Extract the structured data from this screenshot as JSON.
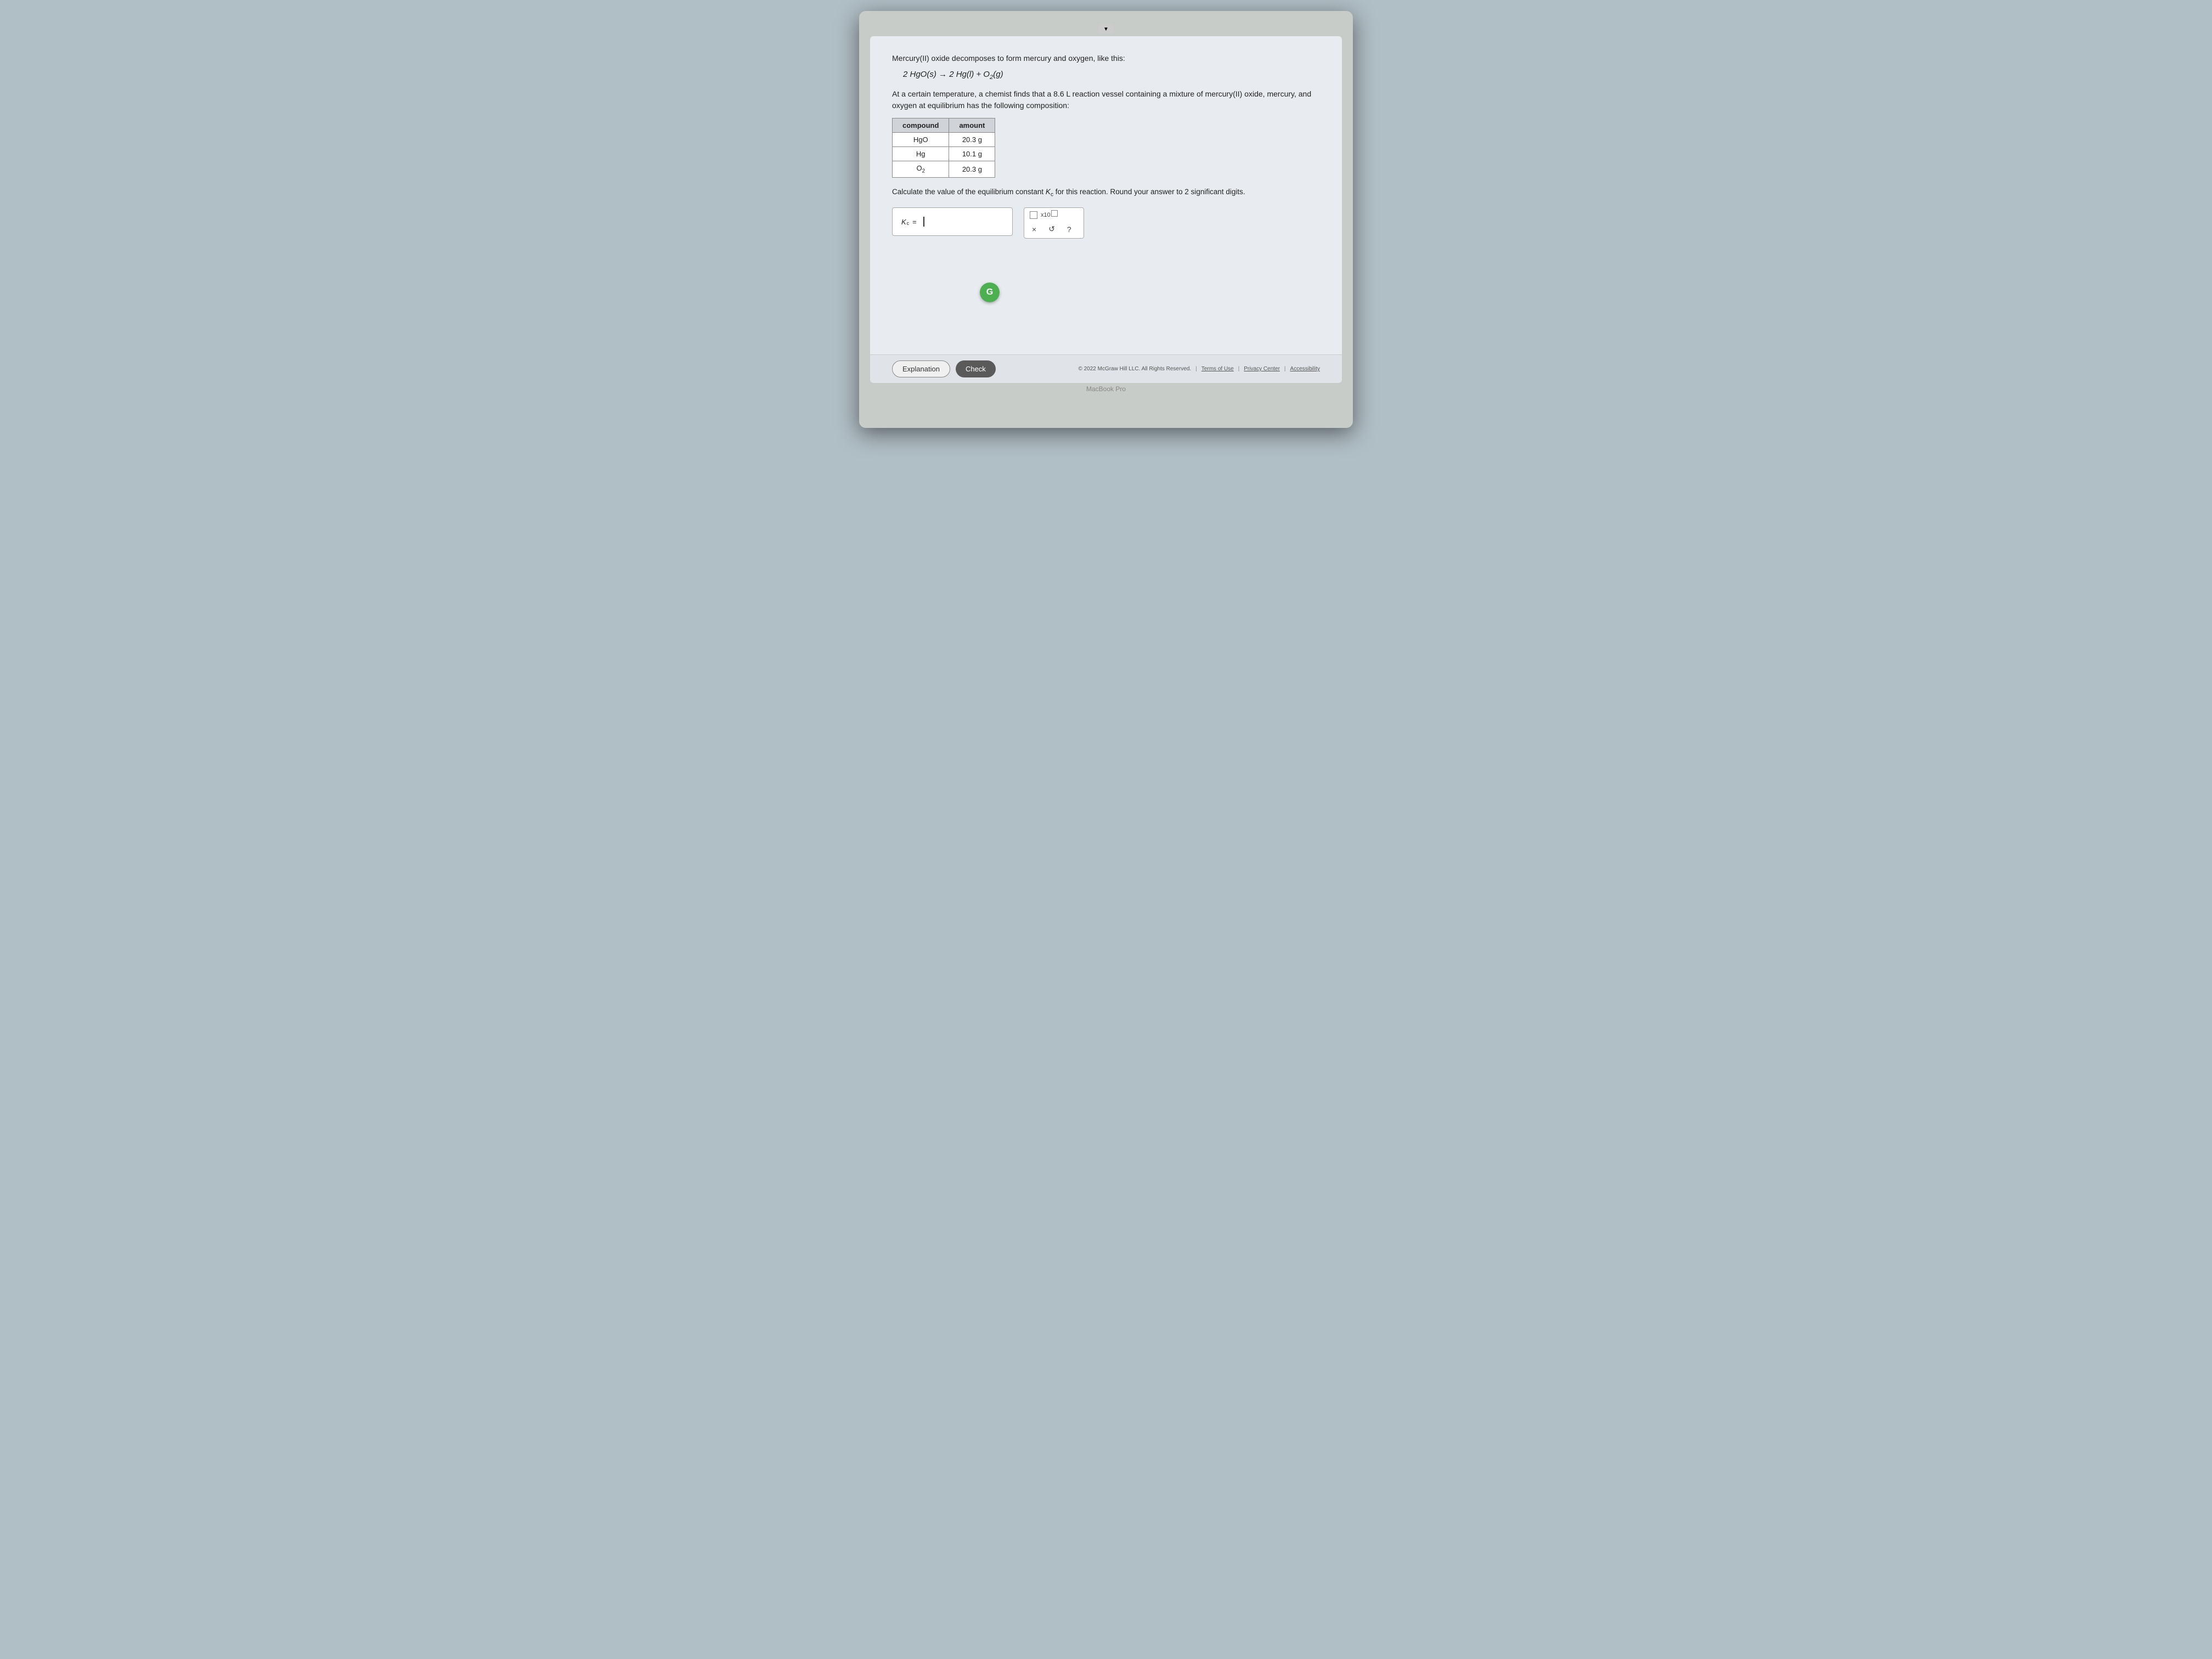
{
  "header": {
    "chevron_label": "▼"
  },
  "problem": {
    "intro": "Mercury(II) oxide decomposes to form mercury and oxygen, like this:",
    "equation": "2 HgO(s) → 2 Hg(l) + O₂(g)",
    "context": "At a certain temperature, a chemist finds that a 8.6 L reaction vessel containing a mixture of mercury(II) oxide, mercury, and oxygen at equilibrium has the following composition:",
    "table": {
      "headers": [
        "compound",
        "amount"
      ],
      "rows": [
        {
          "compound": "HgO",
          "amount": "20.3 g"
        },
        {
          "compound": "Hg",
          "amount": "10.1 g"
        },
        {
          "compound": "O₂",
          "amount": "20.3 g"
        }
      ]
    },
    "question": "Calculate the value of the equilibrium constant K",
    "question_sub": "c",
    "question_rest": " for this reaction. Round your answer to 2 significant digits.",
    "kc_label": "K",
    "kc_sub": "c",
    "kc_equals": "="
  },
  "toolbar": {
    "x10_label": "x10",
    "x10_sup": "□",
    "cross_label": "×",
    "undo_label": "↺",
    "help_label": "?"
  },
  "g_button": {
    "label": "G"
  },
  "footer": {
    "explanation_label": "Explanation",
    "check_label": "Check",
    "copyright": "© 2022 McGraw Hill LLC. All Rights Reserved.",
    "terms": "Terms of Use",
    "privacy": "Privacy Center",
    "accessibility": "Accessibility"
  },
  "macbook": {
    "label": "MacBook Pro"
  }
}
